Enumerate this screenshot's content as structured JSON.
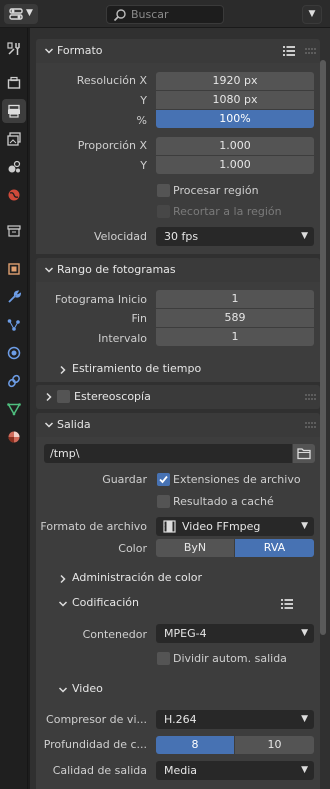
{
  "header": {
    "search_placeholder": "Buscar"
  },
  "icons": {
    "editor_type": "properties-editor-icon",
    "search": "search-icon",
    "tabs": [
      "tool-icon",
      "render-icon",
      "output-icon",
      "view-layer-icon",
      "scene-icon",
      "world-icon",
      "collection-icon",
      "object-icon",
      "modifiers-icon",
      "particles-icon",
      "physics-icon",
      "constraints-icon",
      "data-icon",
      "material-icon"
    ]
  },
  "accent_color": "#4772b3",
  "format": {
    "title": "Formato",
    "res_x_label": "Resolución X",
    "res_x_value": "1920 px",
    "res_y_label": "Y",
    "res_y_value": "1080 px",
    "res_pct_label": "%",
    "res_pct_value": "100%",
    "aspect_x_label": "Proporción X",
    "aspect_x_value": "1.000",
    "aspect_y_label": "Y",
    "aspect_y_value": "1.000",
    "render_region_label": "Procesar región",
    "crop_label": "Recortar a la región",
    "fps_label": "Velocidad",
    "fps_value": "30 fps"
  },
  "frame_range": {
    "title": "Rango de fotogramas",
    "start_label": "Fotograma Inicio",
    "start_value": "1",
    "end_label": "Fin",
    "end_value": "589",
    "step_label": "Intervalo",
    "step_value": "1",
    "time_stretch_label": "Estiramiento de tiempo"
  },
  "stereoscopy": {
    "title": "Estereoscopía"
  },
  "output": {
    "title": "Salida",
    "path": "/tmp\\",
    "save_label": "Guardar",
    "file_ext_label": "Extensiones de archivo",
    "cache_label": "Resultado a caché",
    "file_format_label": "Formato de archivo",
    "file_format_value": "Video FFmpeg",
    "color_label": "Color",
    "color_options": [
      "ByN",
      "RVA"
    ],
    "color_mgmt_label": "Administración de color"
  },
  "encoding": {
    "title": "Codificación",
    "container_label": "Contenedor",
    "container_value": "MPEG-4",
    "autosplit_label": "Dividir autom. salida",
    "video_title": "Video",
    "codec_label": "Compresor de vi...",
    "codec_value": "H.264",
    "depth_label": "Profundidad de c...",
    "depth_options": [
      "8",
      "10"
    ],
    "quality_label": "Calidad de salida",
    "quality_value": "Media"
  }
}
